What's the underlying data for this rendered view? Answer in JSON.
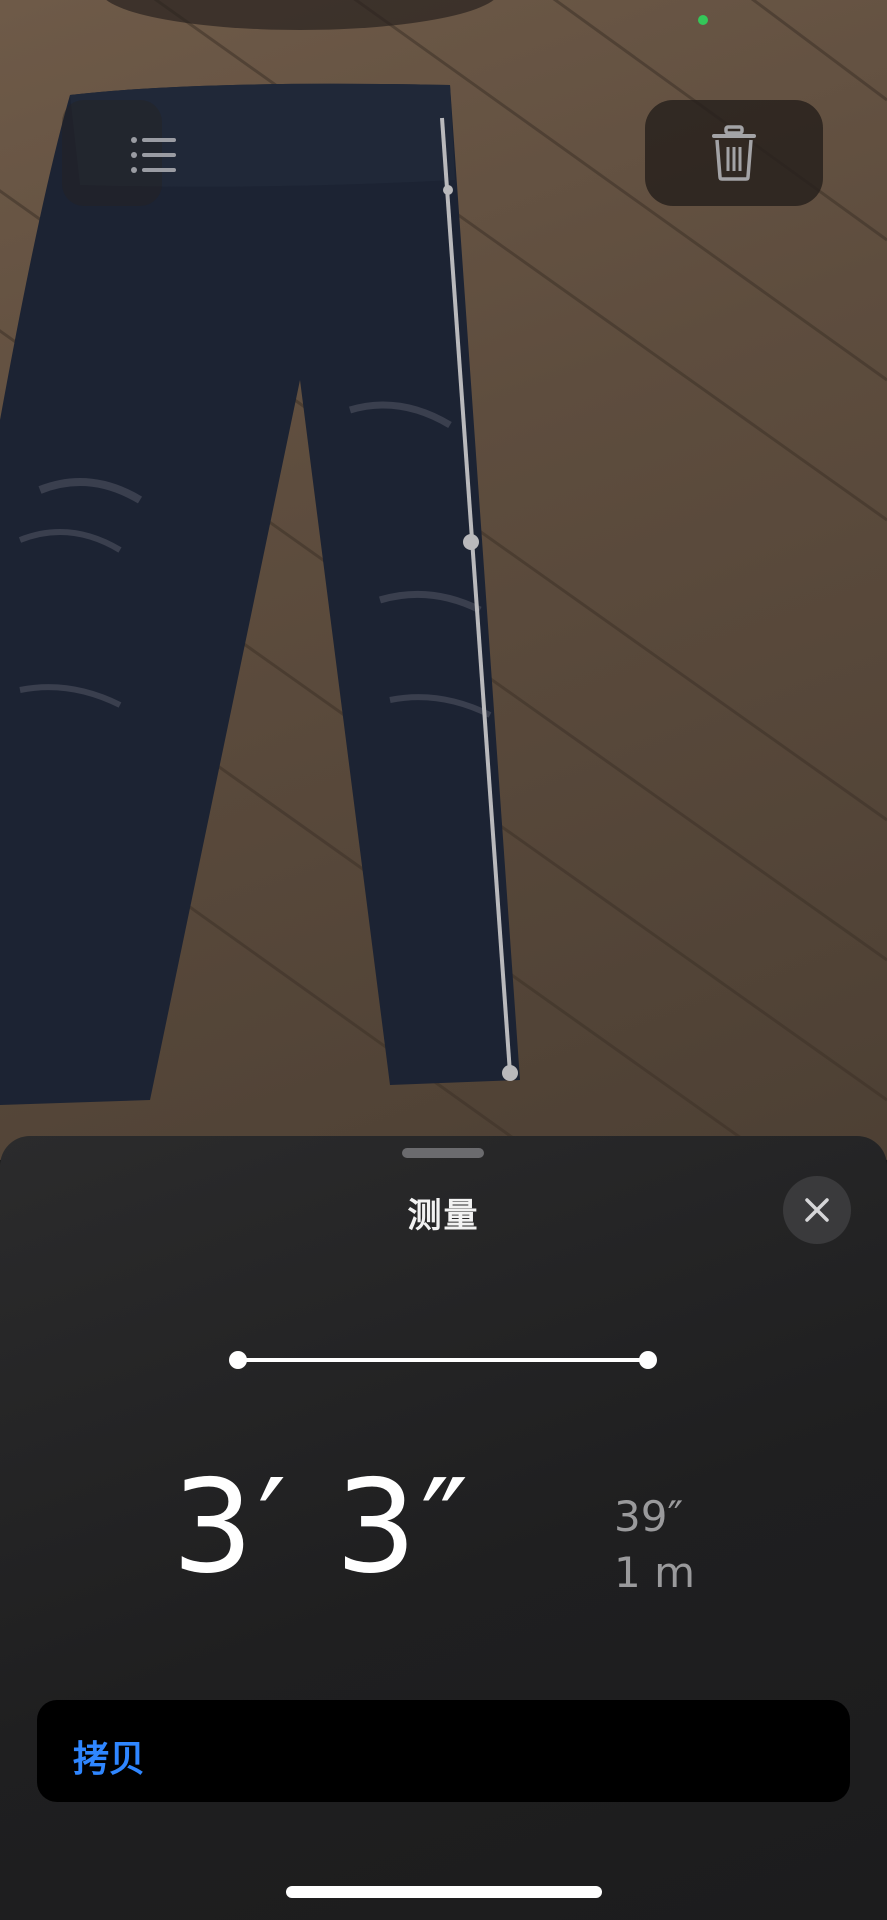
{
  "status": {
    "indicator_color": "#34c759"
  },
  "toolbar": {
    "list_icon": "list-icon",
    "trash_icon": "trash-icon"
  },
  "sheet": {
    "title": "测量",
    "close_icon": "close-icon",
    "measurement": {
      "primary": "3′ 3″",
      "secondary_inches": "39″",
      "secondary_meters": "1 m"
    },
    "copy_label": "拷贝"
  },
  "colors": {
    "accent": "#2f86ff",
    "sheet_background": "#1f1f20",
    "copy_button_background": "#000000"
  }
}
